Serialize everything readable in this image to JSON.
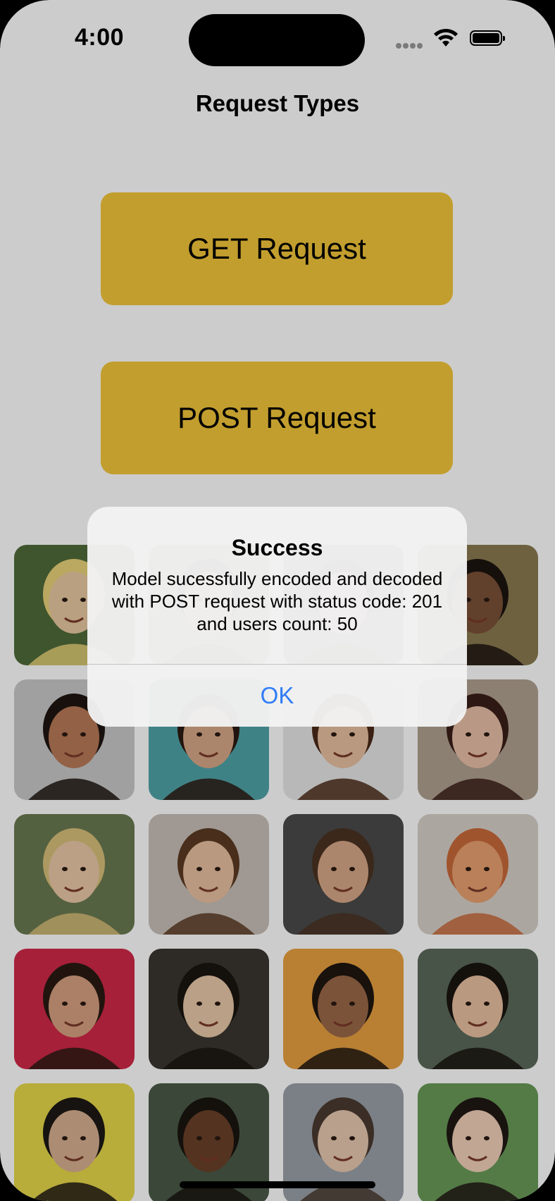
{
  "status_bar": {
    "time": "4:00"
  },
  "nav": {
    "title": "Request Types"
  },
  "buttons": {
    "get_label": "GET Request",
    "post_label": "POST Request"
  },
  "colors": {
    "button_bg": "#f3c63a",
    "alert_action": "#2f7df6",
    "dim_overlay": "rgba(0,0,0,0.2)"
  },
  "photos": [
    {
      "label": "user-photo-1"
    },
    {
      "label": "user-photo-2"
    },
    {
      "label": "user-photo-3"
    },
    {
      "label": "user-photo-4"
    },
    {
      "label": "user-photo-5"
    },
    {
      "label": "user-photo-6"
    },
    {
      "label": "user-photo-7"
    },
    {
      "label": "user-photo-8"
    },
    {
      "label": "user-photo-9"
    },
    {
      "label": "user-photo-10"
    },
    {
      "label": "user-photo-11"
    },
    {
      "label": "user-photo-12"
    },
    {
      "label": "user-photo-13"
    },
    {
      "label": "user-photo-14"
    },
    {
      "label": "user-photo-15"
    },
    {
      "label": "user-photo-16"
    },
    {
      "label": "user-photo-17"
    },
    {
      "label": "user-photo-18"
    },
    {
      "label": "user-photo-19"
    },
    {
      "label": "user-photo-20"
    }
  ],
  "alert": {
    "title": "Success",
    "message": "Model sucessfully encoded and decoded with POST request with status code: 201 and users count: 50",
    "ok_label": "OK"
  }
}
